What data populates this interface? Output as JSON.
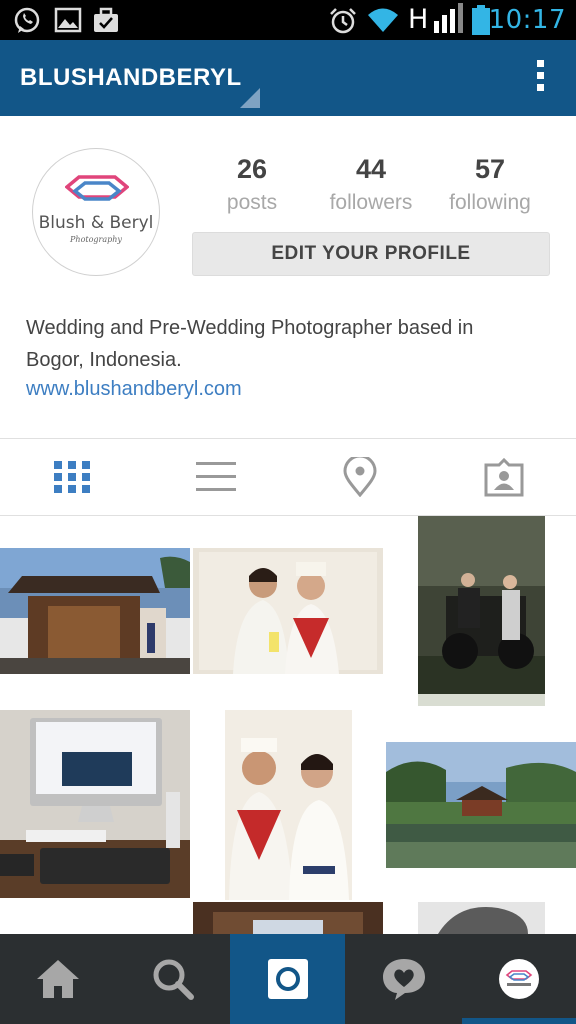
{
  "status_bar": {
    "time": "10:17",
    "network_label": "H",
    "icons": [
      "whatsapp-icon",
      "gallery-icon",
      "briefcase-icon",
      "alarm-icon",
      "wifi-icon",
      "signal-icon",
      "battery-icon"
    ]
  },
  "app_bar": {
    "username": "BLUSHANDBERYL",
    "menu_icon": "overflow-menu-icon"
  },
  "profile": {
    "avatar": {
      "logo_name": "Blush & Beryl",
      "logo_sub": "Photography"
    },
    "stats": [
      {
        "value": "26",
        "label": "posts"
      },
      {
        "value": "44",
        "label": "followers"
      },
      {
        "value": "57",
        "label": "following"
      }
    ],
    "edit_button_label": "EDIT YOUR PROFILE",
    "bio_line1": "Wedding and Pre-Wedding Photographer based in",
    "bio_line2": "Bogor, Indonesia.",
    "website": "www.blushandberyl.com"
  },
  "tabs": [
    {
      "icon": "grid-view-icon",
      "active": true
    },
    {
      "icon": "list-view-icon",
      "active": false
    },
    {
      "icon": "map-pin-icon",
      "active": false
    },
    {
      "icon": "tagged-photos-icon",
      "active": false
    }
  ],
  "bottom_nav": [
    {
      "icon": "home-icon"
    },
    {
      "icon": "search-icon"
    },
    {
      "icon": "camera-icon",
      "active": true
    },
    {
      "icon": "activity-heart-icon"
    },
    {
      "icon": "profile-avatar-icon"
    }
  ],
  "colors": {
    "brand_blue": "#125688",
    "status_blue": "#33b5e5",
    "link_blue": "#3d7ec2",
    "nav_dark": "#2b2f31",
    "logo_pink": "#e0457b",
    "logo_blue": "#4a86c8"
  }
}
